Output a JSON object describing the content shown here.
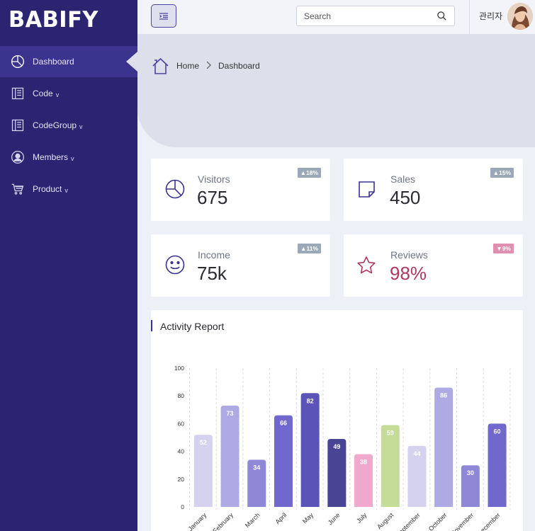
{
  "sidebar": {
    "logo": "BABIFY",
    "items": [
      {
        "label": "Dashboard",
        "icon": "pie-chart-icon",
        "has_caret": false
      },
      {
        "label": "Code",
        "icon": "list-icon",
        "has_caret": true
      },
      {
        "label": "CodeGroup",
        "icon": "list-icon",
        "has_caret": true
      },
      {
        "label": "Members",
        "icon": "user-circle-icon",
        "has_caret": true
      },
      {
        "label": "Product",
        "icon": "cart-icon",
        "has_caret": true
      }
    ],
    "caret": "v"
  },
  "header": {
    "search_placeholder": "Search",
    "username": "관리자"
  },
  "breadcrumb": {
    "home": "Home",
    "current": "Dashboard"
  },
  "stats": [
    {
      "label": "Visitors",
      "value": "675",
      "badge": "18%",
      "badge_dir": "up",
      "icon": "pie-chart-icon"
    },
    {
      "label": "Sales",
      "value": "450",
      "badge": "15%",
      "badge_dir": "up",
      "icon": "note-icon"
    },
    {
      "label": "Income",
      "value": "75k",
      "badge": "11%",
      "badge_dir": "up",
      "icon": "smile-icon"
    },
    {
      "label": "Reviews",
      "value": "98%",
      "badge": "9%",
      "badge_dir": "down",
      "icon": "star-icon"
    }
  ],
  "colors": {
    "sidebar_bg": "#2a2471",
    "active_bg": "#3b348f",
    "accent": "#4b44a2",
    "badge_up": "#9aa8b8",
    "badge_down": "#e08fb0",
    "reviews_value": "#b0385e"
  },
  "activity": {
    "title": "Activity Report"
  },
  "chart_data": {
    "type": "bar",
    "categories": [
      "January",
      "February",
      "March",
      "April",
      "May",
      "June",
      "July",
      "August",
      "September",
      "October",
      "November",
      "December"
    ],
    "values": [
      52,
      73,
      34,
      66,
      82,
      49,
      38,
      59,
      44,
      86,
      30,
      60
    ],
    "colors": [
      "#d4d2ee",
      "#aeaae3",
      "#8f88d6",
      "#7068cd",
      "#5b53b7",
      "#4a4495",
      "#f0a8cc",
      "#c4dc98",
      "#d4d2ee",
      "#aeaae3",
      "#8f88d6",
      "#7068cd"
    ],
    "ylim": [
      0,
      100
    ],
    "yticks": [
      0,
      20,
      40,
      60,
      80,
      100
    ],
    "grid": true
  }
}
